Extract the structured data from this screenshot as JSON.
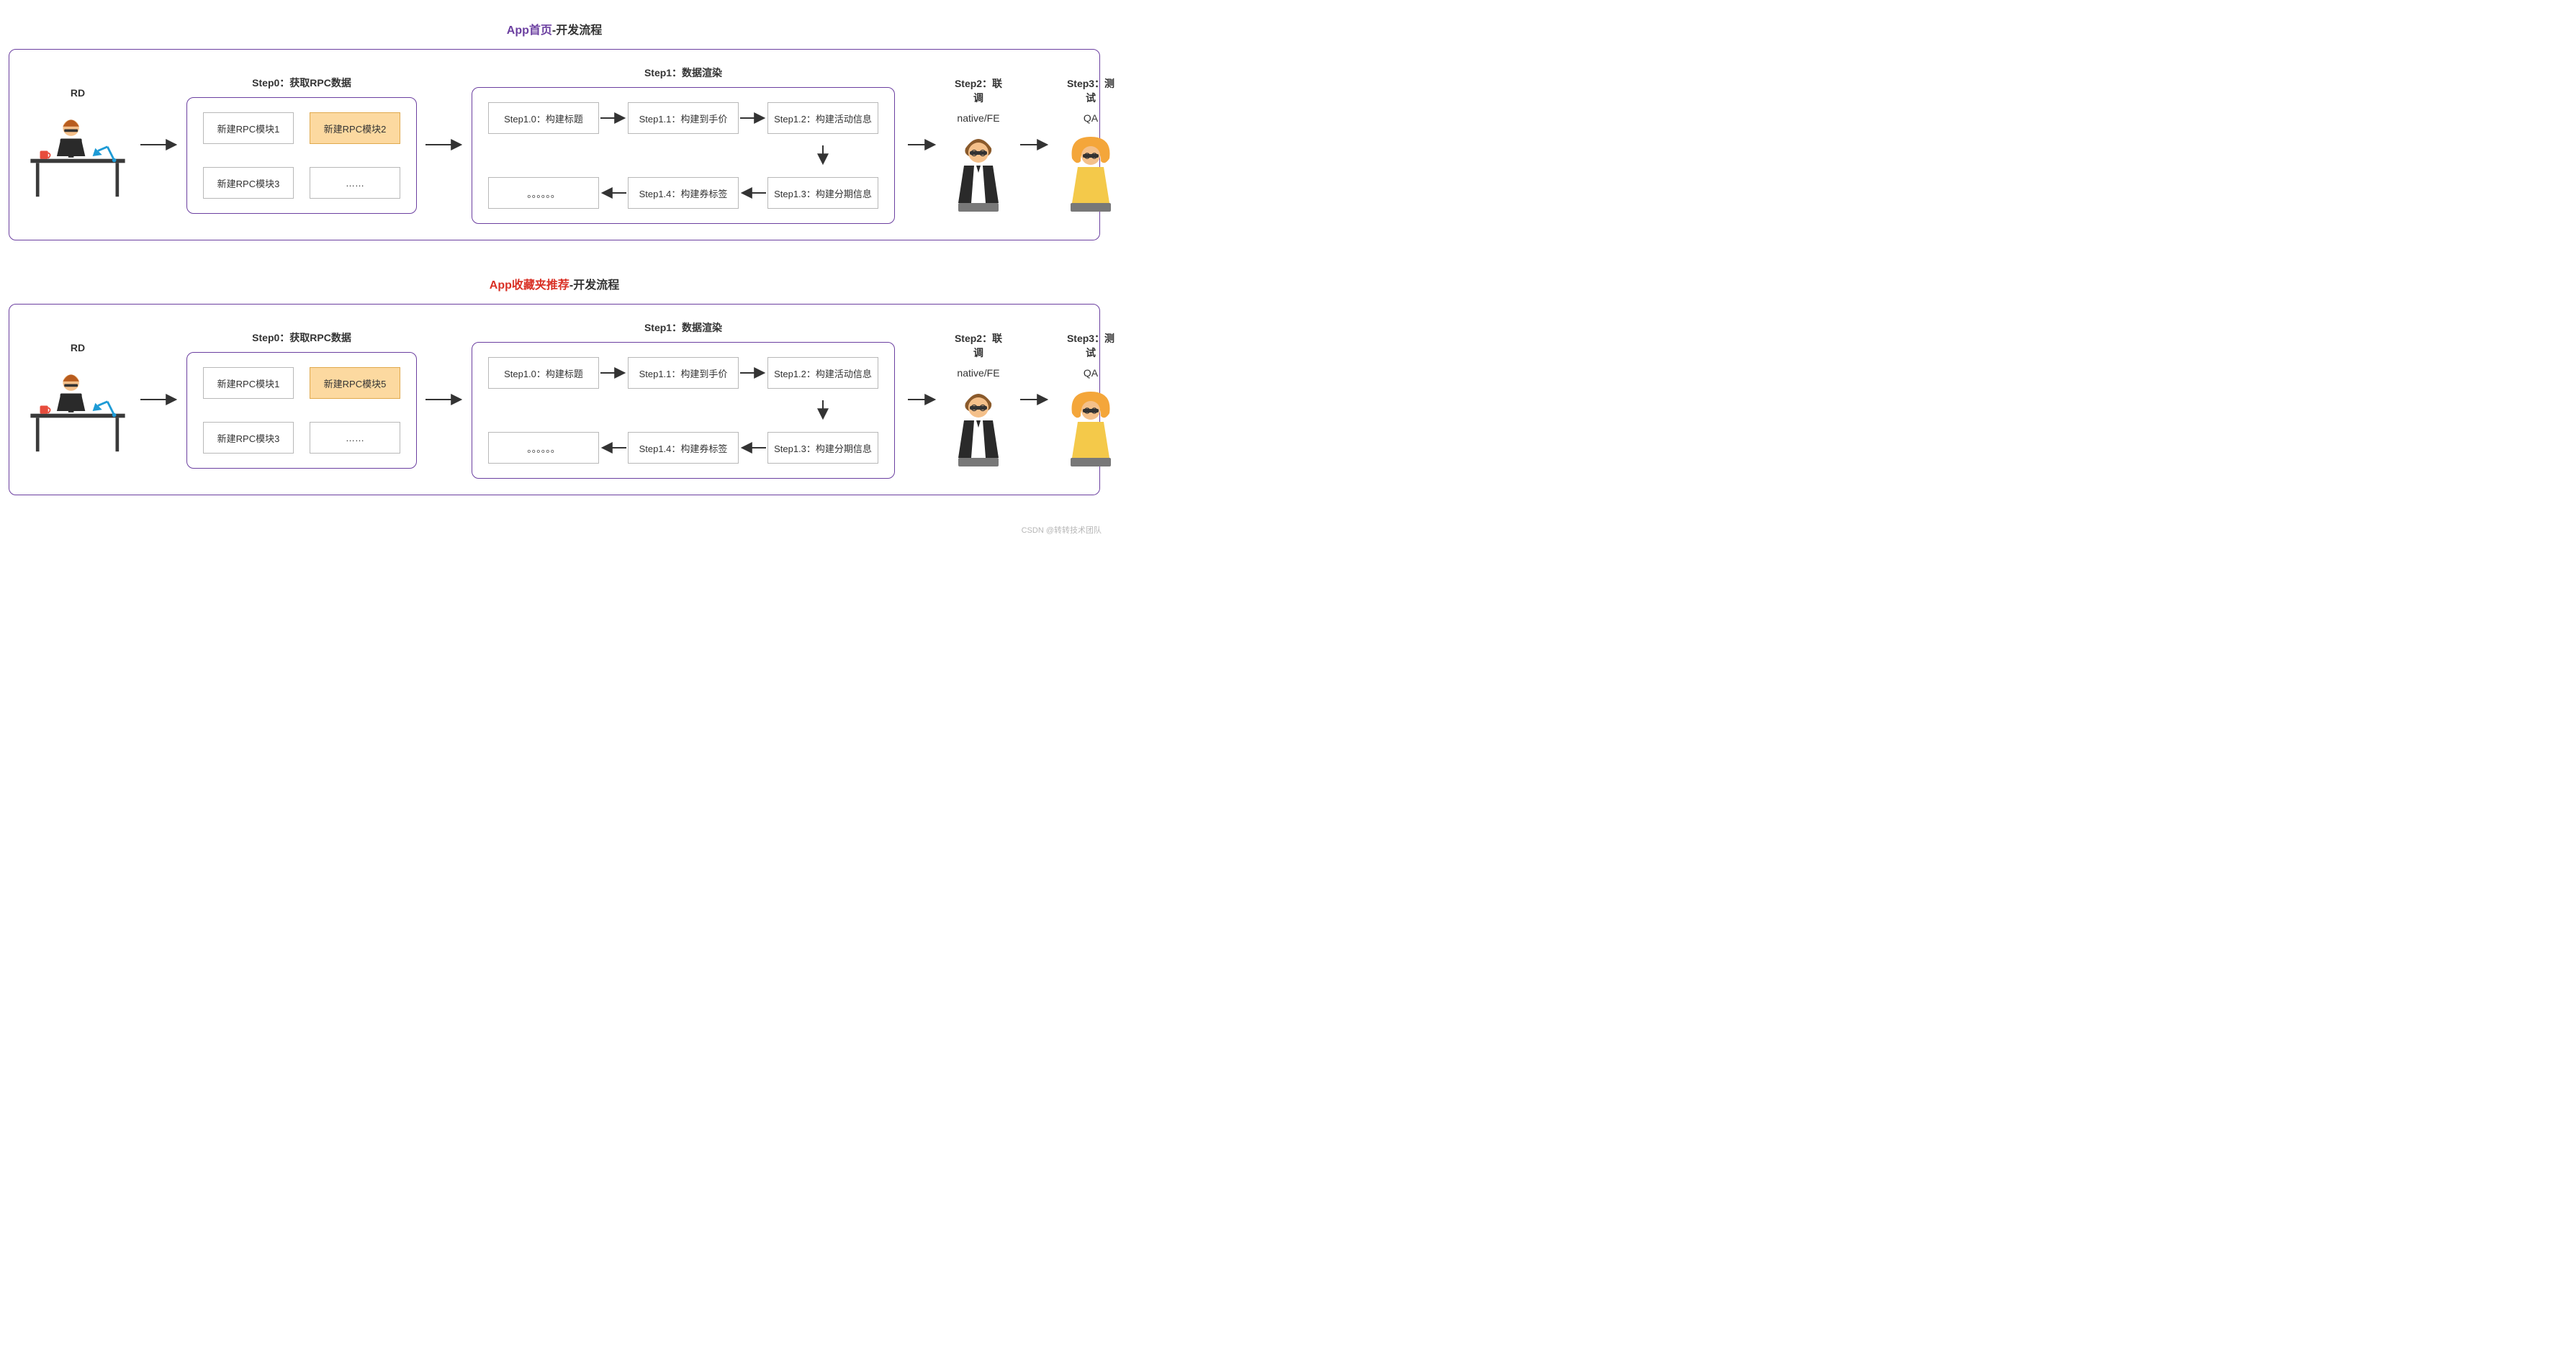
{
  "watermark": "CSDN @转转技术团队",
  "sections": [
    {
      "title_accent": "App首页",
      "title_accent_class": "accent-purple",
      "title_suffix": "-开发流程",
      "rd_label": "RD",
      "step0": {
        "label": "Step0：获取RPC数据",
        "cells": [
          "新建RPC模块1",
          "新建RPC模块2",
          "新建RPC模块3",
          "……"
        ],
        "highlight_index": 1
      },
      "step1": {
        "label": "Step1：数据渲染",
        "nodes": {
          "n0": "Step1.0：构建标题",
          "n1": "Step1.1：构建到手价",
          "n2": "Step1.2：构建活动信息",
          "n3": "Step1.3：构建分期信息",
          "n4": "Step1.4：构建券标签",
          "ellipsis": "。。。。。。"
        }
      },
      "step2": {
        "label": "Step2：联调",
        "person_label": "native/FE"
      },
      "step3": {
        "label": "Step3：测试",
        "person_label": "QA"
      }
    },
    {
      "title_accent": "App收藏夹推荐",
      "title_accent_class": "accent-red",
      "title_suffix": "-开发流程",
      "rd_label": "RD",
      "step0": {
        "label": "Step0：获取RPC数据",
        "cells": [
          "新建RPC模块1",
          "新建RPC模块5",
          "新建RPC模块3",
          "……"
        ],
        "highlight_index": 1
      },
      "step1": {
        "label": "Step1：数据渲染",
        "nodes": {
          "n0": "Step1.0：构建标题",
          "n1": "Step1.1：构建到手价",
          "n2": "Step1.2：构建活动信息",
          "n3": "Step1.3：构建分期信息",
          "n4": "Step1.4：构建券标签",
          "ellipsis": "。。。。。。"
        }
      },
      "step2": {
        "label": "Step2：联调",
        "person_label": "native/FE"
      },
      "step3": {
        "label": "Step3：测试",
        "person_label": "QA"
      }
    }
  ]
}
